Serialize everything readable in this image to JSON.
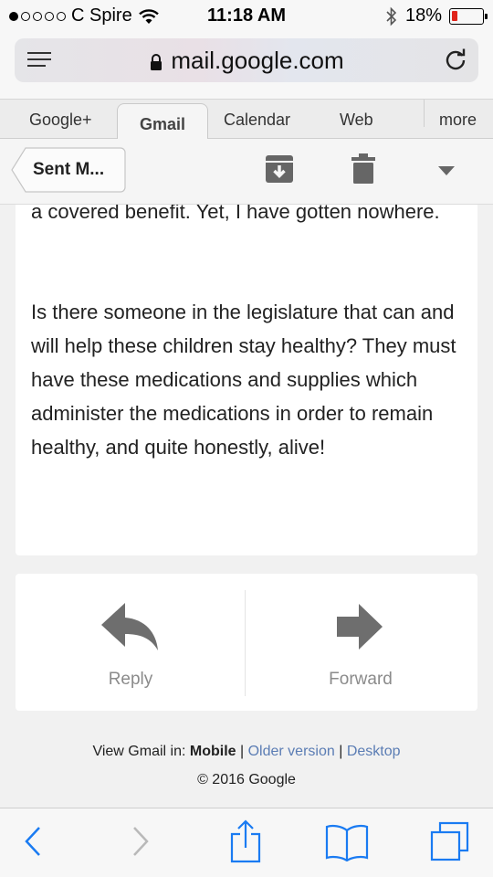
{
  "status_bar": {
    "carrier": "C Spire",
    "time": "11:18 AM",
    "battery_percent": "18%",
    "battery_level": 0.18,
    "signal_dots_filled": 1,
    "signal_dots_total": 5
  },
  "browser": {
    "url": "mail.google.com"
  },
  "google_tabs": {
    "items": [
      "Google+",
      "Gmail",
      "Calendar",
      "Web",
      "more"
    ],
    "active": "Gmail"
  },
  "toolbar": {
    "back_label": "Sent M..."
  },
  "email": {
    "paragraph_1": "a covered benefit. Yet, I have gotten nowhere.",
    "paragraph_2": "Is there someone in the legislature that can and will help these children stay healthy? They must have these medications and supplies which administer the medications in order to remain healthy, and quite honestly,  alive!"
  },
  "actions": {
    "reply_label": "Reply",
    "forward_label": "Forward"
  },
  "footer": {
    "view_in": "View Gmail in:",
    "mobile": "Mobile",
    "sep": "|",
    "older": "Older version",
    "desktop": "Desktop",
    "copyright": "© 2016 Google"
  },
  "colors": {
    "accent_link": "#5b7db4",
    "safari_blue": "#1a7bf2",
    "battery_low": "#e0241b"
  }
}
